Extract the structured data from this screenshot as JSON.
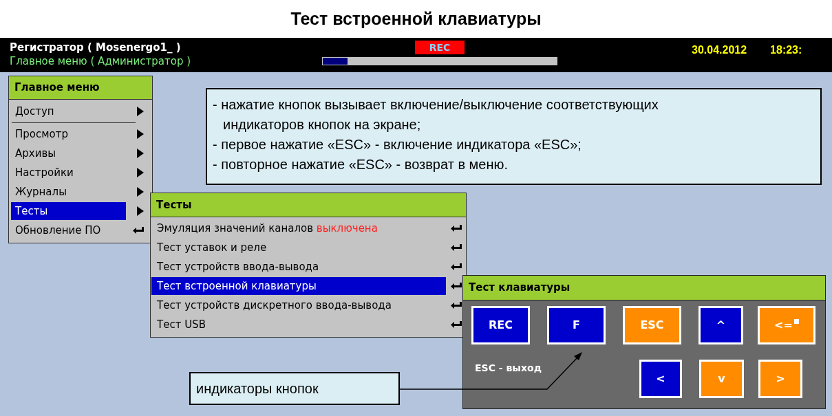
{
  "doc_title": "Тест встроенной клавиатуры",
  "header": {
    "device": "Регистратор ( Mosenergo1_ )",
    "context": "Главное меню ( Администратор )",
    "rec": "REC",
    "progress": {
      "level": 0.11
    },
    "date": "30.04.2012",
    "time": "18:23:"
  },
  "main_menu": {
    "title": "Главное меню",
    "items": [
      {
        "label": "Доступ",
        "kind": "submenu",
        "selected": false,
        "separator_after": true
      },
      {
        "label": "Просмотр",
        "kind": "submenu",
        "selected": false,
        "separator_after": false
      },
      {
        "label": "Архивы",
        "kind": "submenu",
        "selected": false,
        "separator_after": false
      },
      {
        "label": "Настройки",
        "kind": "submenu",
        "selected": false,
        "separator_after": false
      },
      {
        "label": "Журналы",
        "kind": "submenu",
        "selected": false,
        "separator_after": false
      },
      {
        "label": "Тесты",
        "kind": "submenu",
        "selected": true,
        "separator_after": false
      },
      {
        "label": "Обновление ПО",
        "kind": "action",
        "selected": false,
        "separator_after": false
      }
    ]
  },
  "tests_menu": {
    "title": "Тесты",
    "items": [
      {
        "label": "Эмуляция значений каналов",
        "status": "выключена",
        "selected": false
      },
      {
        "label": "Тест уставок и реле",
        "selected": false
      },
      {
        "label": "Тест устройств ввода-вывода",
        "selected": false
      },
      {
        "label": "Тест встроенной клавиатуры",
        "selected": true
      },
      {
        "label": "Тест устройств дискретного ввода-вывода",
        "selected": false
      },
      {
        "label": "Тест USB",
        "selected": false
      }
    ]
  },
  "keyboard_test": {
    "title": "Тест клавиатуры",
    "hint": "ESC - выход",
    "rows": [
      [
        {
          "label": "REC",
          "on": false
        },
        {
          "label": "F",
          "on": false
        },
        {
          "label": "ESC",
          "on": true
        },
        {
          "label": "^",
          "on": false
        },
        {
          "label": "<=",
          "on": true,
          "kind": "backspace"
        }
      ],
      [
        "",
        "",
        {
          "label": "<",
          "on": false
        },
        {
          "label": "v",
          "on": true
        },
        {
          "label": ">",
          "on": true
        }
      ]
    ]
  },
  "notes": {
    "lines": [
      "- нажатие кнопок вызывает включение/выключение соответствующих",
      "индикаторов кнопок на экране;",
      "- первое нажатие «ESC» - включение индикатора «ESC»;",
      "- повторное нажатие «ESC» - возврат в меню."
    ]
  },
  "callout": "индикаторы кнопок"
}
